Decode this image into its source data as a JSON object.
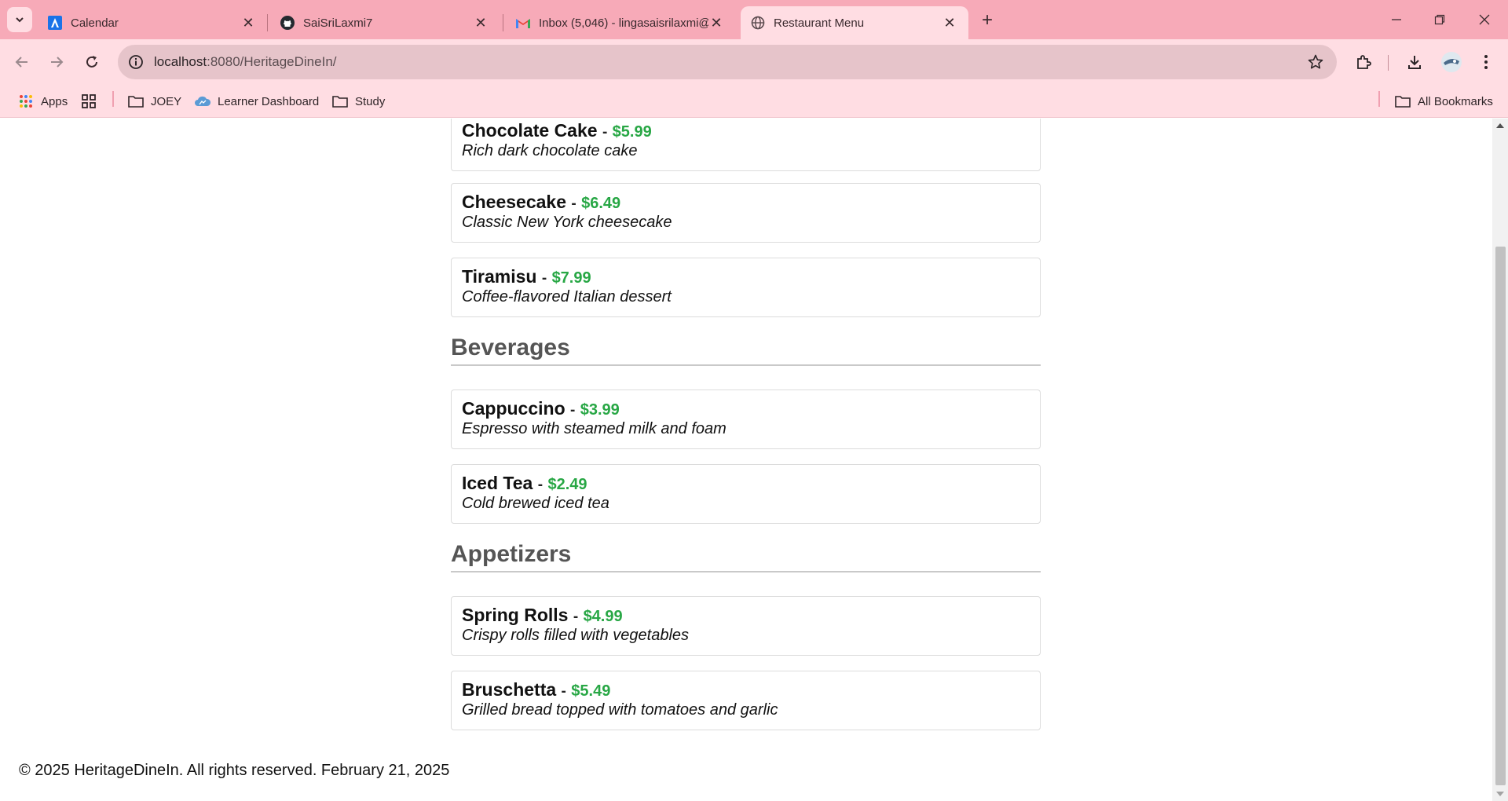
{
  "tabs": [
    {
      "title": "Calendar",
      "icon": "google-calendar-icon"
    },
    {
      "title": "SaiSriLaxmi7",
      "icon": "github-icon"
    },
    {
      "title": "Inbox (5,046) - lingasaisrilaxmi@",
      "icon": "gmail-icon"
    },
    {
      "title": "Restaurant Menu",
      "icon": "globe-icon",
      "active": true
    }
  ],
  "address_bar": {
    "host": "localhost",
    "path": ":8080/HeritageDineIn/"
  },
  "bookmarks": [
    {
      "label": "Apps",
      "icon": "apps-grid-icon"
    },
    {
      "label": "",
      "icon": "tab-groups-icon"
    },
    {
      "label": "JOEY",
      "icon": "folder-icon"
    },
    {
      "label": "Learner Dashboard",
      "icon": "cloud-icon"
    },
    {
      "label": "Study",
      "icon": "folder-icon"
    },
    {
      "label": "All Bookmarks",
      "icon": "folder-icon"
    }
  ],
  "menu": {
    "desserts_items": [
      {
        "name": "Chocolate Cake",
        "price": "$5.99",
        "description": "Rich dark chocolate cake"
      },
      {
        "name": "Cheesecake",
        "price": "$6.49",
        "description": "Classic New York cheesecake"
      },
      {
        "name": "Tiramisu",
        "price": "$7.99",
        "description": "Coffee-flavored Italian dessert"
      }
    ],
    "beverages": {
      "title": "Beverages",
      "items": [
        {
          "name": "Cappuccino",
          "price": "$3.99",
          "description": "Espresso with steamed milk and foam"
        },
        {
          "name": "Iced Tea",
          "price": "$2.49",
          "description": "Cold brewed iced tea"
        }
      ]
    },
    "appetizers": {
      "title": "Appetizers",
      "items": [
        {
          "name": "Spring Rolls",
          "price": "$4.99",
          "description": "Crispy rolls filled with vegetables"
        },
        {
          "name": "Bruschetta",
          "price": "$5.49",
          "description": "Grilled bread topped with tomatoes and garlic"
        }
      ]
    },
    "separator": "-"
  },
  "footer": {
    "text": "© 2025 HeritageDineIn. All rights reserved. February 21, 2025"
  },
  "colors": {
    "chrome_tabbar": "#f7aab8",
    "chrome_toolbar": "#ffdde3",
    "price": "#28a745",
    "section_title": "#555555"
  }
}
